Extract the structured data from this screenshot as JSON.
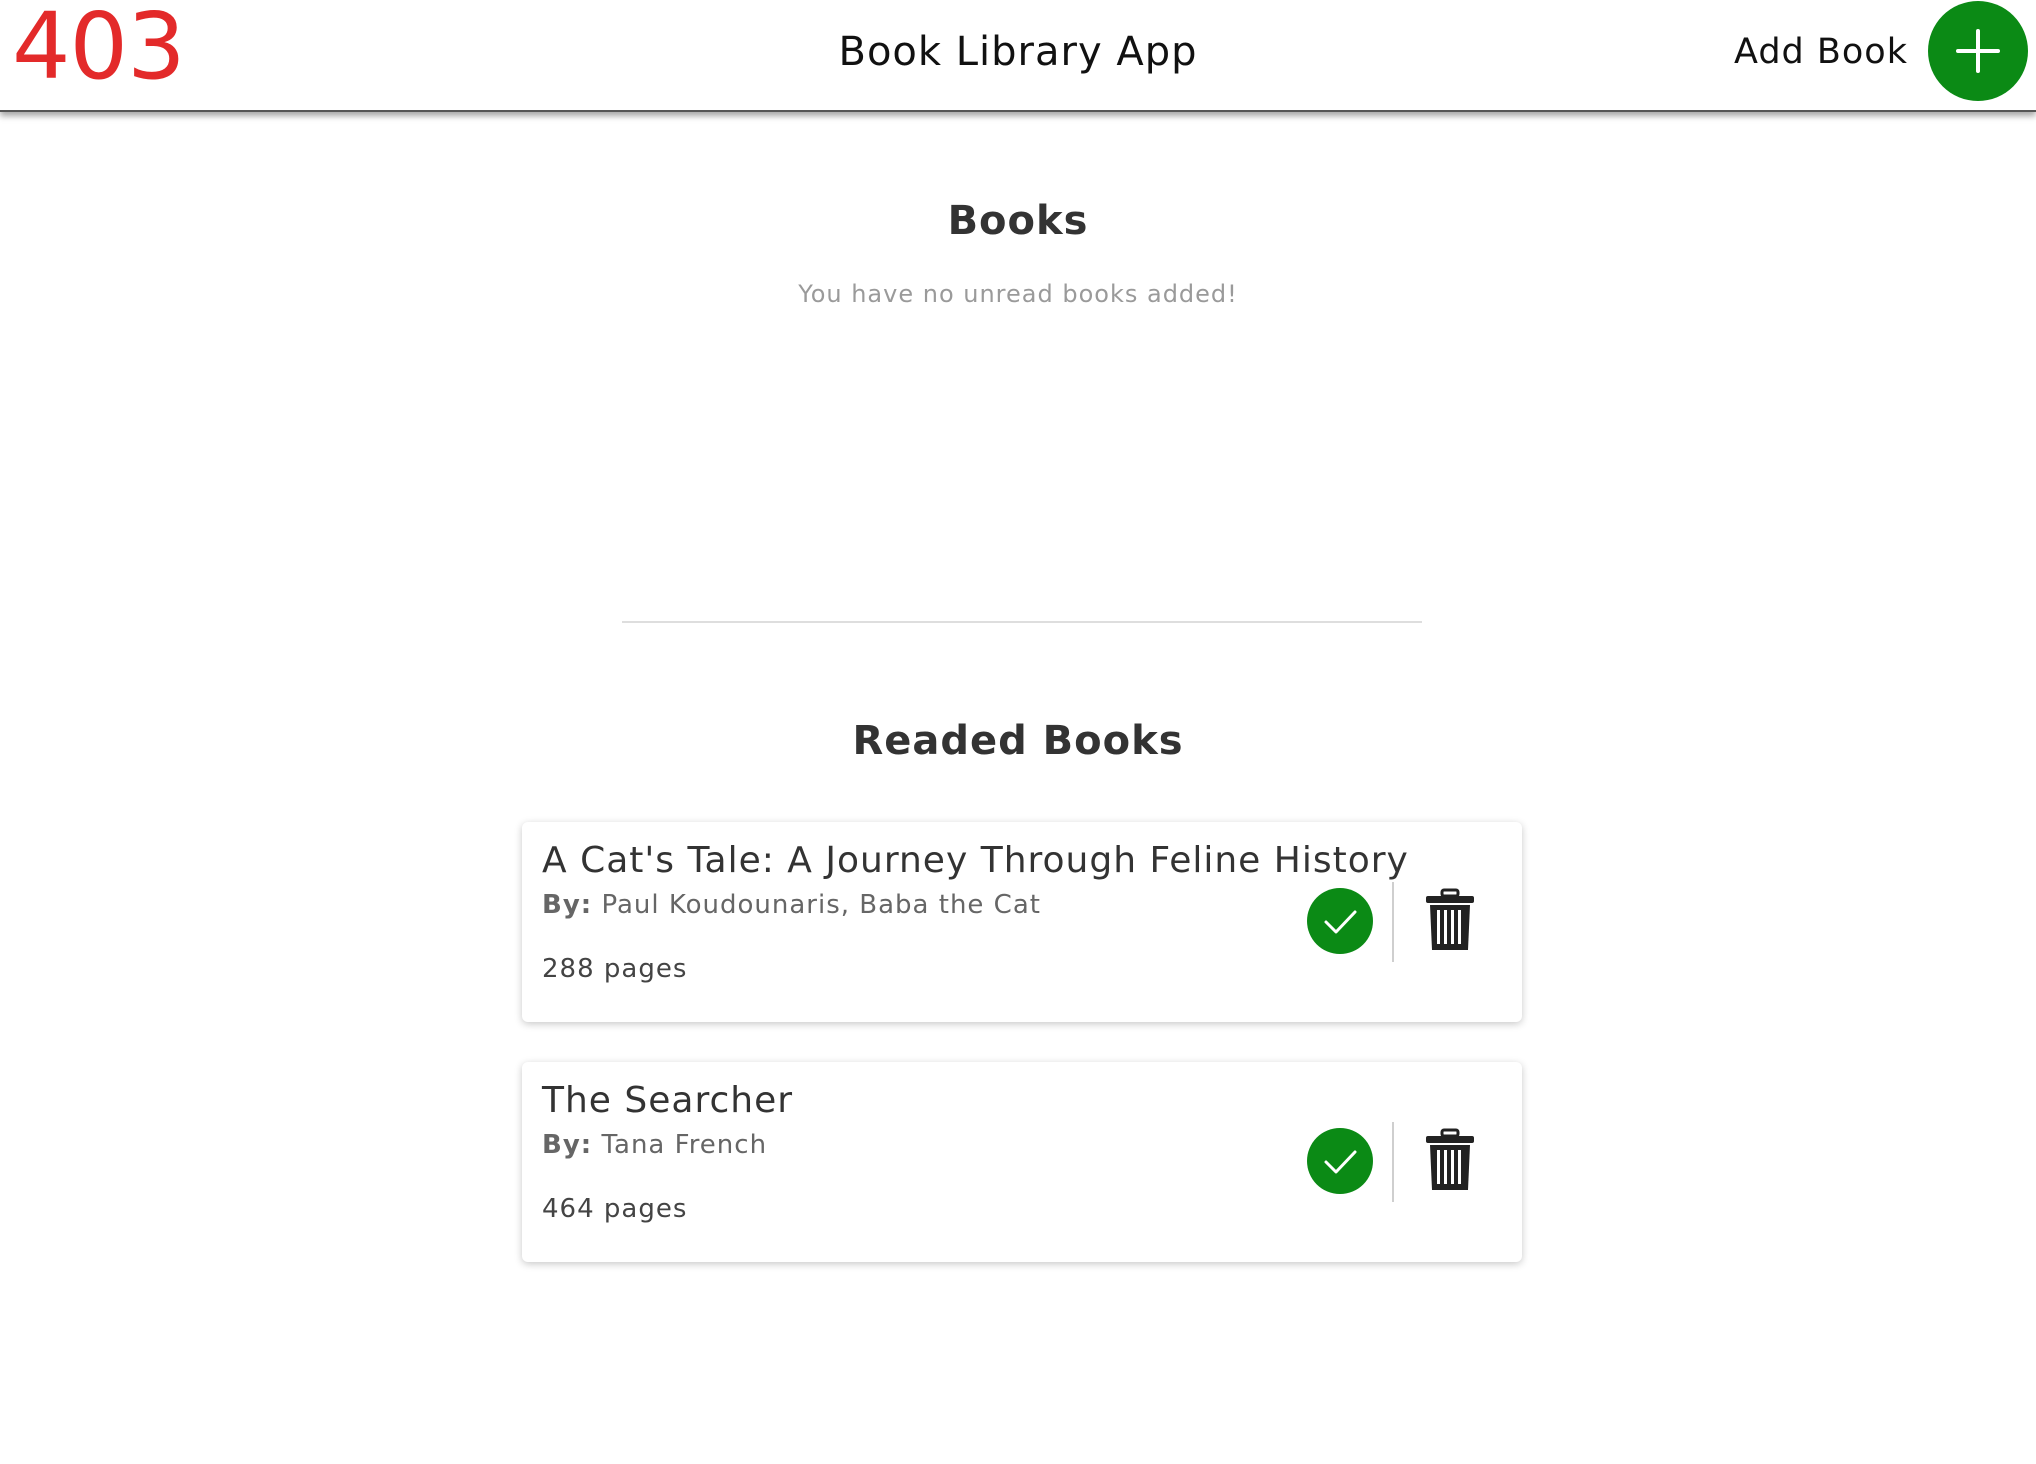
{
  "header": {
    "code_text": "403",
    "title": "Book Library App",
    "add_book_label": "Add Book",
    "accent_color": "#0b8a15",
    "code_color": "#e32a2a"
  },
  "unread": {
    "title": "Books",
    "empty_message": "You have no unread books added!"
  },
  "read": {
    "title": "Readed Books",
    "books": [
      {
        "title": "A Cat's Tale: A Journey Through Feline History",
        "by_label": "By:",
        "author": "Paul Koudounaris, Baba the Cat",
        "pages": "288 pages",
        "read_icon": "check-icon",
        "delete_icon": "trash-icon"
      },
      {
        "title": "The Searcher",
        "by_label": "By:",
        "author": "Tana French",
        "pages": "464 pages",
        "read_icon": "check-icon",
        "delete_icon": "trash-icon"
      }
    ]
  }
}
